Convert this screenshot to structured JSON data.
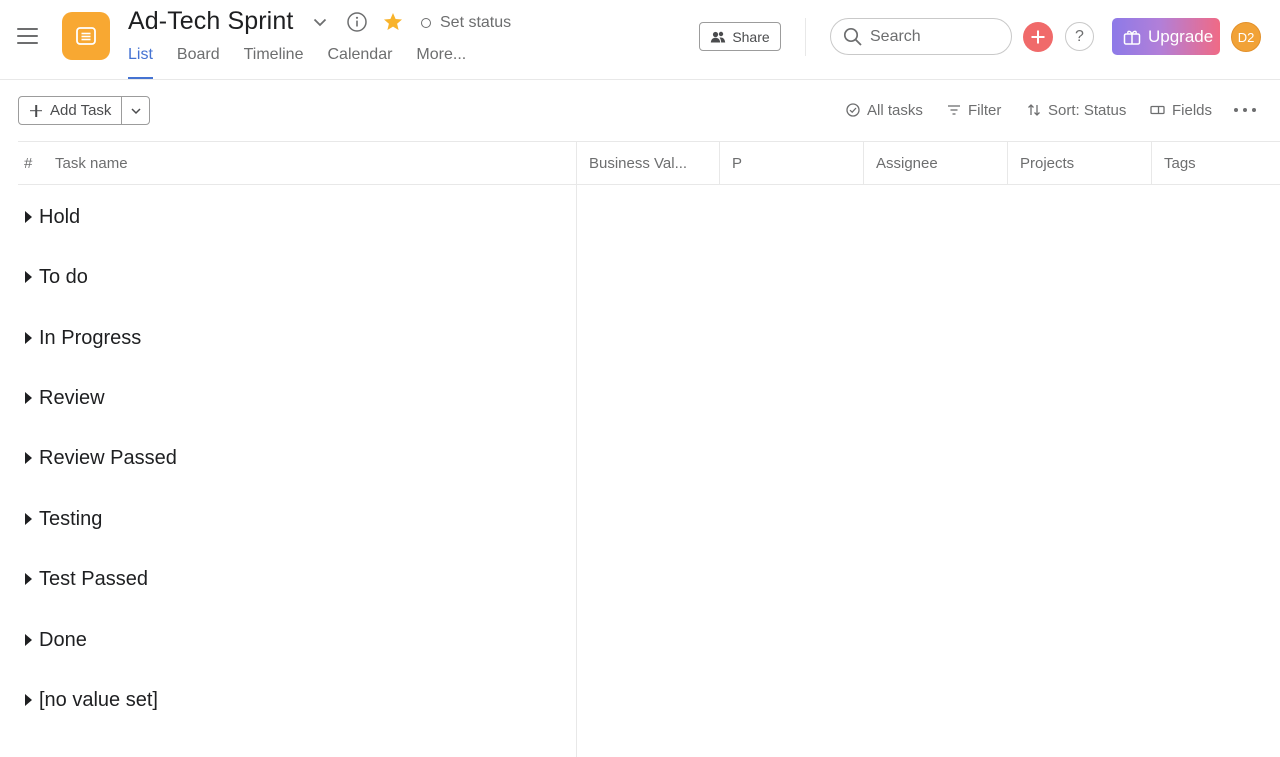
{
  "header": {
    "project_title": "Ad-Tech Sprint",
    "set_status_label": "Set status",
    "tabs": [
      {
        "label": "List",
        "active": true
      },
      {
        "label": "Board",
        "active": false
      },
      {
        "label": "Timeline",
        "active": false
      },
      {
        "label": "Calendar",
        "active": false
      },
      {
        "label": "More...",
        "active": false
      }
    ],
    "share_label": "Share",
    "search_placeholder": "Search",
    "help_label": "?",
    "upgrade_label": "Upgrade",
    "avatar_initials": "D2",
    "colors": {
      "project_icon": "#f8a832",
      "accent": "#4573d2",
      "plus_button": "#f06a6a",
      "avatar": "#f1a237",
      "star": "#f8b32b"
    }
  },
  "toolbar": {
    "add_task_label": "Add Task",
    "all_tasks_label": "All tasks",
    "filter_label": "Filter",
    "sort_label": "Sort: Status",
    "fields_label": "Fields"
  },
  "table": {
    "columns": {
      "number": "#",
      "task_name": "Task name",
      "business_value": "Business Val...",
      "priority": "P",
      "assignee": "Assignee",
      "projects": "Projects",
      "tags": "Tags"
    },
    "sections": [
      "Hold",
      "To do",
      "In Progress",
      "Review",
      "Review Passed",
      "Testing",
      "Test Passed",
      "Done",
      "[no value set]"
    ]
  }
}
